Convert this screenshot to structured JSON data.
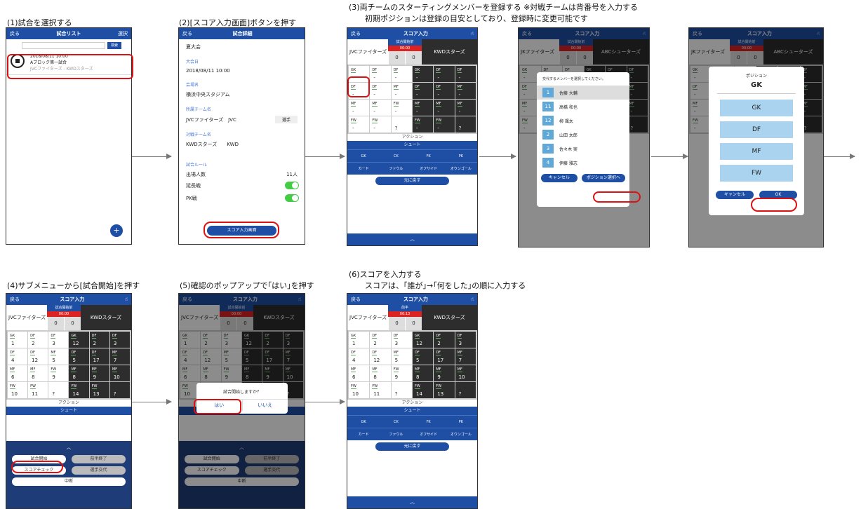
{
  "captions": {
    "c1": "(1)試合を選択する",
    "c2": "(2)[スコア入力画面]ボタンを押す",
    "c3": "(3)両チームのスターティングメンバーを登録する ※対戦チームは背番号を入力する",
    "c3b": "初期ポジションは登録の目安としており、登録時に変更可能です",
    "c4": "(4)サブメニューから[試合開始]を押す",
    "c5": "(5)確認のポップアップで｢はい｣を押す",
    "c6": "(6)スコアを入力する",
    "c6b": "スコアは、｢誰が｣→｢何をした｣の順に入力する"
  },
  "nav": {
    "back": "戻る",
    "select": "選択",
    "list_title": "試合リスト",
    "detail_title": "試合詳細",
    "score_title": "スコア入力"
  },
  "list": {
    "search": "検索",
    "date": "2018/08/11 10:00",
    "name": "Aブロック第一試合",
    "teams": "JVCファイターズ - KWDスターズ",
    "add": "+"
  },
  "detail": {
    "event": "夏大会",
    "date_label": "大会日",
    "date": "2018/08/11 10:00",
    "venue_label": "会場名",
    "venue": "横浜中央スタジアム",
    "team_label": "所属チーム名",
    "team": "JVCファイターズ　JVC",
    "player_btn": "選手",
    "opp_label": "対戦チーム名",
    "opp": "KWDスターズ　　KWD",
    "rule_label": "試合ルール",
    "players": "出場人数",
    "players_val": "11人",
    "extra": "延長戦",
    "pk": "PK戦",
    "score_btn": "スコア入力画面"
  },
  "score": {
    "home": "JVCファイターズ",
    "away": "KWDスターズ",
    "away2": "ABCシューターズ",
    "home2": "JKファイターズ",
    "status": "試合開始前",
    "status_half": "前半",
    "time": "00:00",
    "time2": "00:13",
    "s_home": "0",
    "s_away": "0",
    "action": "アクション",
    "shoot": "シュート",
    "act1": [
      "GK",
      "CK",
      "FK",
      "PK"
    ],
    "act2": [
      "カード",
      "ファウル",
      "オフサイド",
      "オウンゴール"
    ],
    "back": "元に戻す",
    "chev": "︿",
    "pos": [
      "GK",
      "DF",
      "DF",
      "GK",
      "DF",
      "DF",
      "DF",
      "DF",
      "MF",
      "DF",
      "DF",
      "MF",
      "MF",
      "MF",
      "FW",
      "MF",
      "MF",
      "MF",
      "FW",
      "FW",
      "",
      "FW",
      "FW",
      ""
    ],
    "nums": [
      "1",
      "2",
      "3",
      "12",
      "2",
      "3",
      "4",
      "12",
      "5",
      "5",
      "17",
      "7",
      "6",
      "8",
      "9",
      "8",
      "9",
      "10",
      "10",
      "11",
      "?",
      "14",
      "13",
      "?"
    ]
  },
  "member_modal": {
    "title": "交代するメンバーを選択してください。",
    "members": [
      {
        "num": "1",
        "name": "佐藤 大輔"
      },
      {
        "num": "11",
        "name": "高橋 和也"
      },
      {
        "num": "12",
        "name": "柳 颯太"
      },
      {
        "num": "2",
        "name": "山田 太郎"
      },
      {
        "num": "3",
        "name": "佐々木 実"
      },
      {
        "num": "4",
        "name": "伊藤 雅志"
      }
    ],
    "cancel": "キャンセル",
    "next": "ポジション選択へ"
  },
  "position_modal": {
    "title": "ポジション",
    "current": "GK",
    "options": [
      "GK",
      "DF",
      "MF",
      "FW"
    ],
    "cancel": "キャンセル",
    "ok": "OK"
  },
  "submenu": {
    "start": "試合開始",
    "half_end": "前半終了",
    "check": "スコアチェック",
    "sub": "選手交代",
    "stop": "中断"
  },
  "confirm": {
    "text": "試合開始しますか？",
    "yes": "はい",
    "no": "いいえ"
  }
}
